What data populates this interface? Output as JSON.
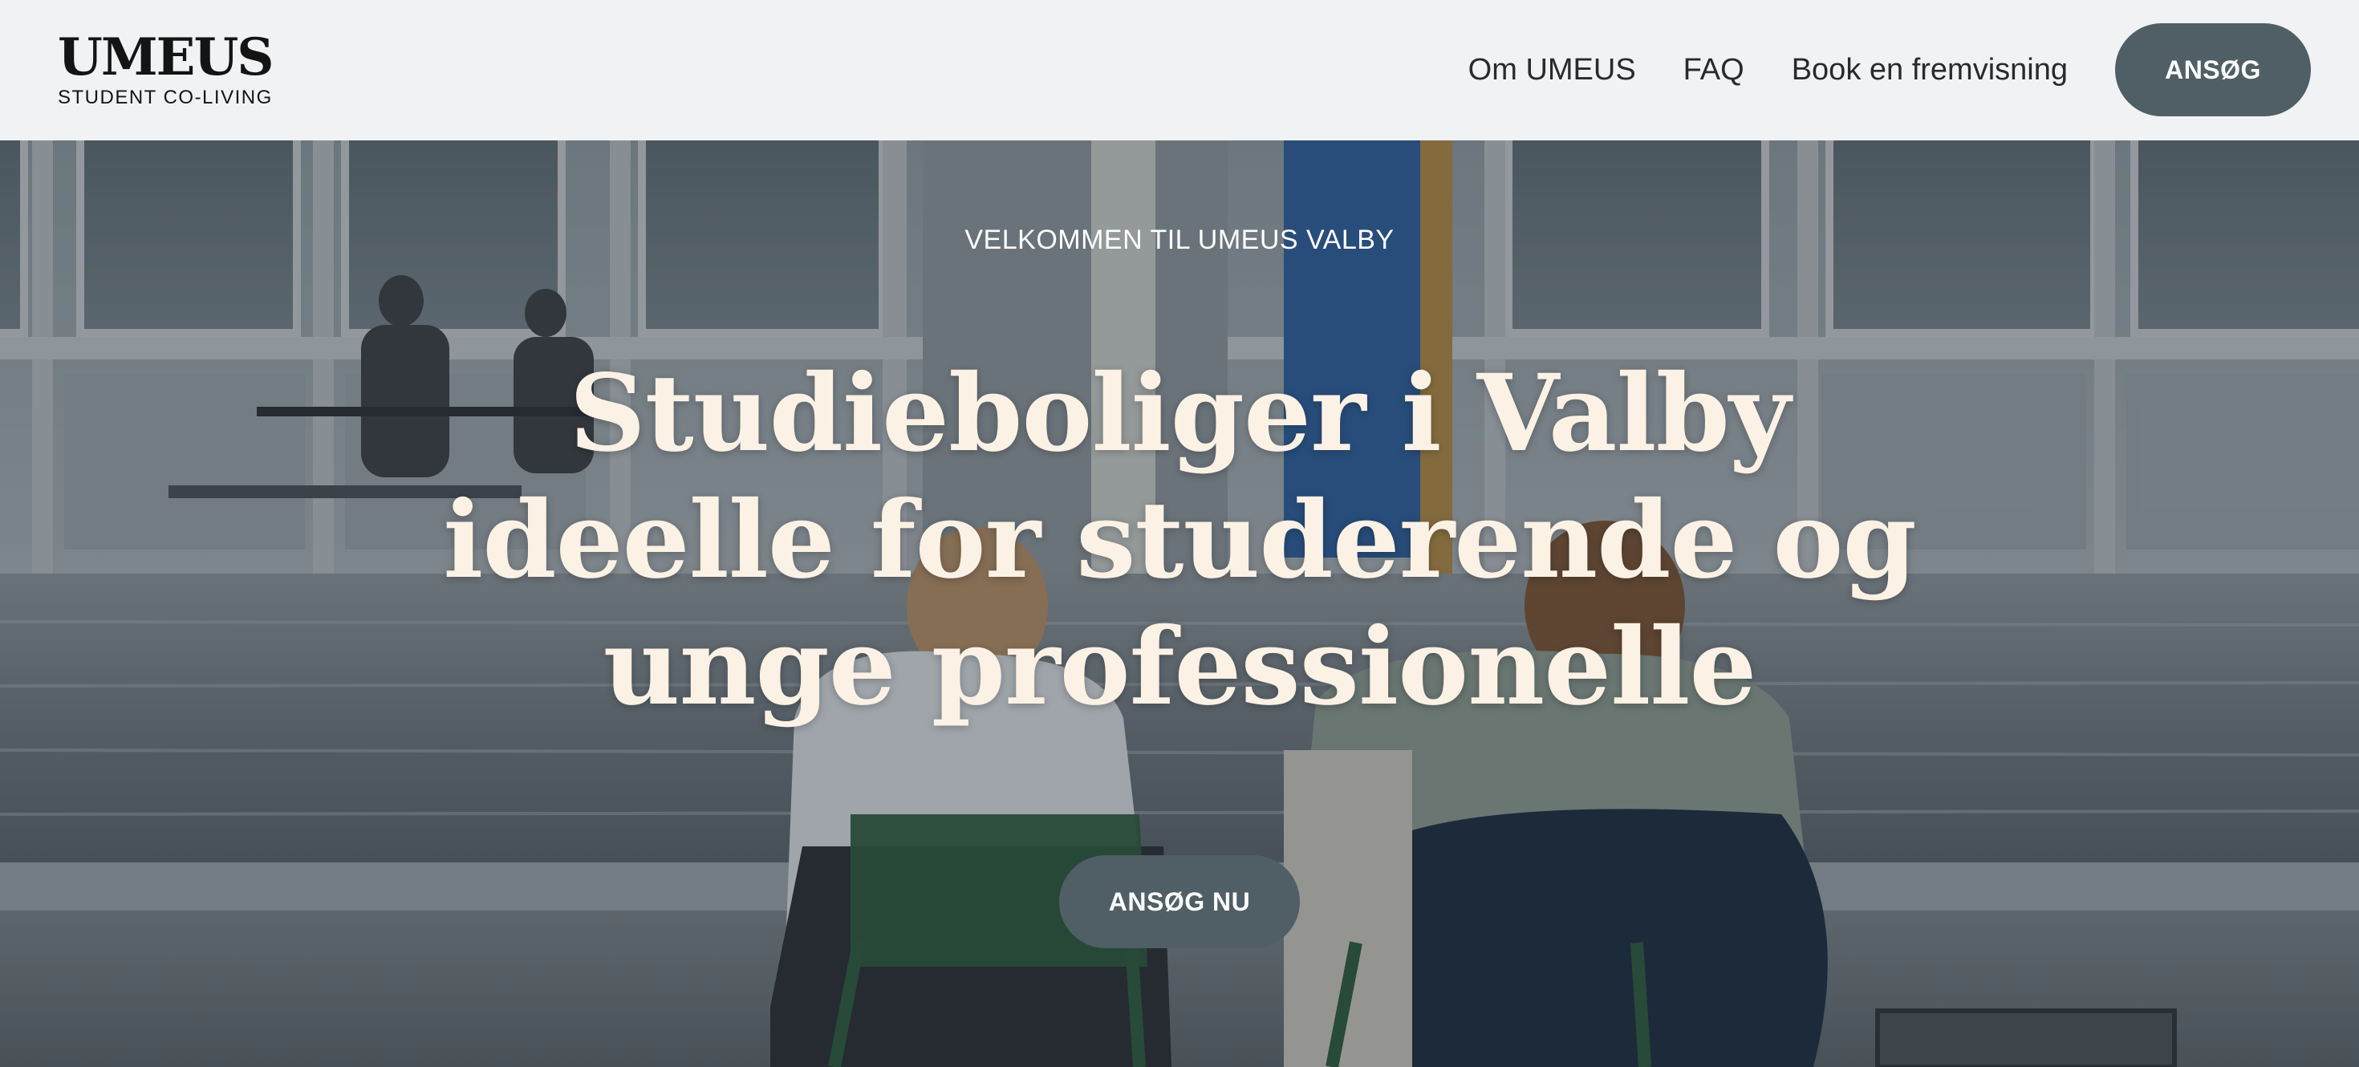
{
  "logo": {
    "wordmark": "UMEUS",
    "tagline": "STUDENT CO-LIVING"
  },
  "nav": {
    "links": [
      {
        "label": "Om UMEUS"
      },
      {
        "label": "FAQ"
      },
      {
        "label": "Book en fremvisning"
      }
    ],
    "apply_label": "ANSØG"
  },
  "hero": {
    "eyebrow": "VELKOMMEN TIL UMEUS VALBY",
    "headline_lines": [
      "Studieboliger i Valby",
      "ideelle for studerende og",
      "unge professionelle"
    ],
    "cta_label": "ANSØG NU"
  },
  "colors": {
    "header_bg": "#f1f2f4",
    "button_bg": "#4f5f65",
    "button_text": "#ffffff",
    "headline_text": "#fbf1e4",
    "logo_text": "#141414"
  }
}
